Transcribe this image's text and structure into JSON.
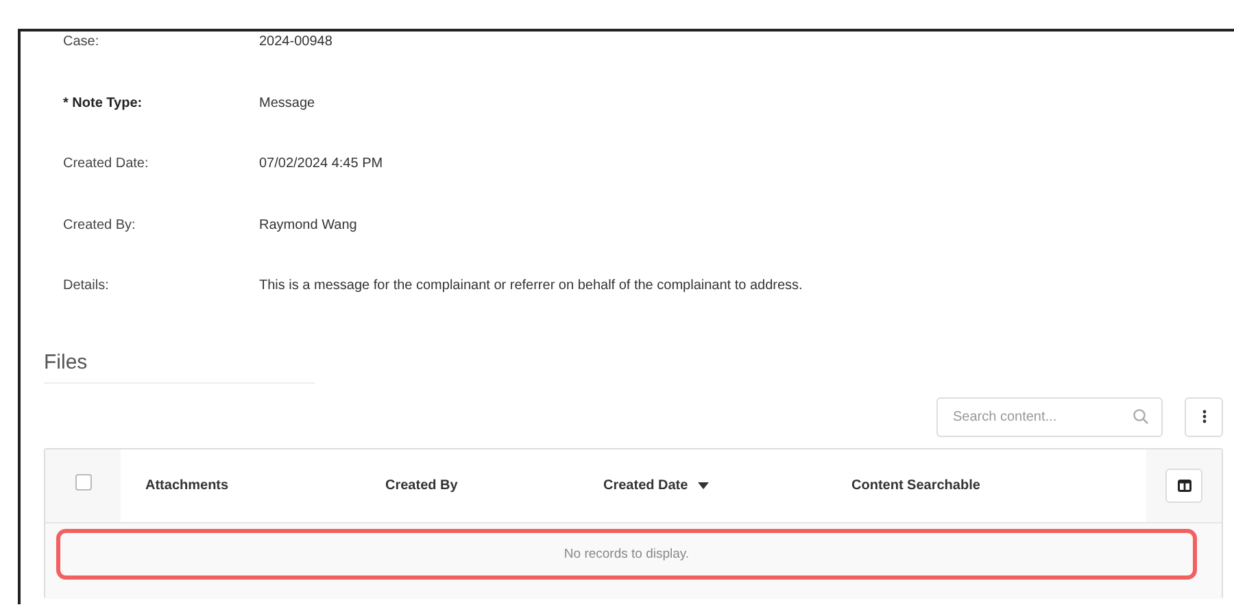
{
  "details": [
    {
      "label": "Case:",
      "value": "2024-00948",
      "required": false
    },
    {
      "label": "* Note Type:",
      "value": "Message",
      "required": true
    },
    {
      "label": "Created Date:",
      "value": "07/02/2024 4:45 PM",
      "required": false
    },
    {
      "label": "Created By:",
      "value": "Raymond Wang",
      "required": false
    },
    {
      "label": "Details:",
      "value": "This is a message for the complainant or referrer on behalf of the complainant to address.",
      "required": false
    }
  ],
  "files": {
    "title": "Files",
    "search": {
      "placeholder": "Search content..."
    },
    "table": {
      "select_all": {
        "checked": false
      },
      "columns": [
        {
          "label": "Attachments",
          "sorted": false
        },
        {
          "label": "Created By",
          "sorted": false
        },
        {
          "label": "Created Date",
          "sorted": true
        },
        {
          "label": "Content Searchable",
          "sorted": false
        }
      ],
      "empty_message": "No records to display."
    }
  }
}
